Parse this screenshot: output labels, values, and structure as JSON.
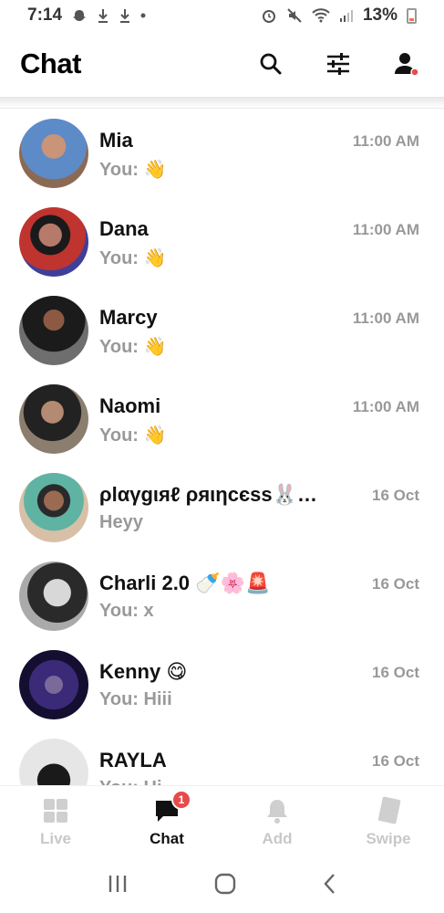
{
  "status_bar": {
    "time": "7:14",
    "battery": "13%"
  },
  "header": {
    "title": "Chat"
  },
  "chats": [
    {
      "name": "Mia",
      "preview": "You: 👋",
      "time": "11:00 AM",
      "avatar_color": "#7fa6d6"
    },
    {
      "name": "Dana",
      "preview": "You: 👋",
      "time": "11:00 AM",
      "avatar_color": "#7a2e5f"
    },
    {
      "name": "Marcy",
      "preview": "You: 👋",
      "time": "11:00 AM",
      "avatar_color": "#5b4a48"
    },
    {
      "name": "Naomi",
      "preview": "You: 👋",
      "time": "11:00 AM",
      "avatar_color": "#6b5b52"
    },
    {
      "name": "ρlαγgιяℓ ρяιηcєss🐰…",
      "preview": "Heyy",
      "time": "16 Oct",
      "avatar_color": "#c89a7a"
    },
    {
      "name": "Charli 2.0 🍼🌸🚨",
      "preview": "You: x",
      "time": "16 Oct",
      "avatar_color": "#8a8a8a"
    },
    {
      "name": "Kenny 😋",
      "preview": "You: Hiii",
      "time": "16 Oct",
      "avatar_color": "#2a1d5a"
    },
    {
      "name": "RAYLA",
      "preview": "You: Hi",
      "time": "16 Oct",
      "avatar_color": "#cfcfcf"
    }
  ],
  "bottom_nav": {
    "items": [
      {
        "label": "Live",
        "icon": "grid-icon"
      },
      {
        "label": "Chat",
        "icon": "chat-bubble-icon",
        "badge": "1"
      },
      {
        "label": "Add",
        "icon": "bell-icon"
      },
      {
        "label": "Swipe",
        "icon": "cards-icon"
      }
    ]
  },
  "colors": {
    "accent": "#111111",
    "muted": "#999999",
    "badge": "#e84a4a"
  }
}
